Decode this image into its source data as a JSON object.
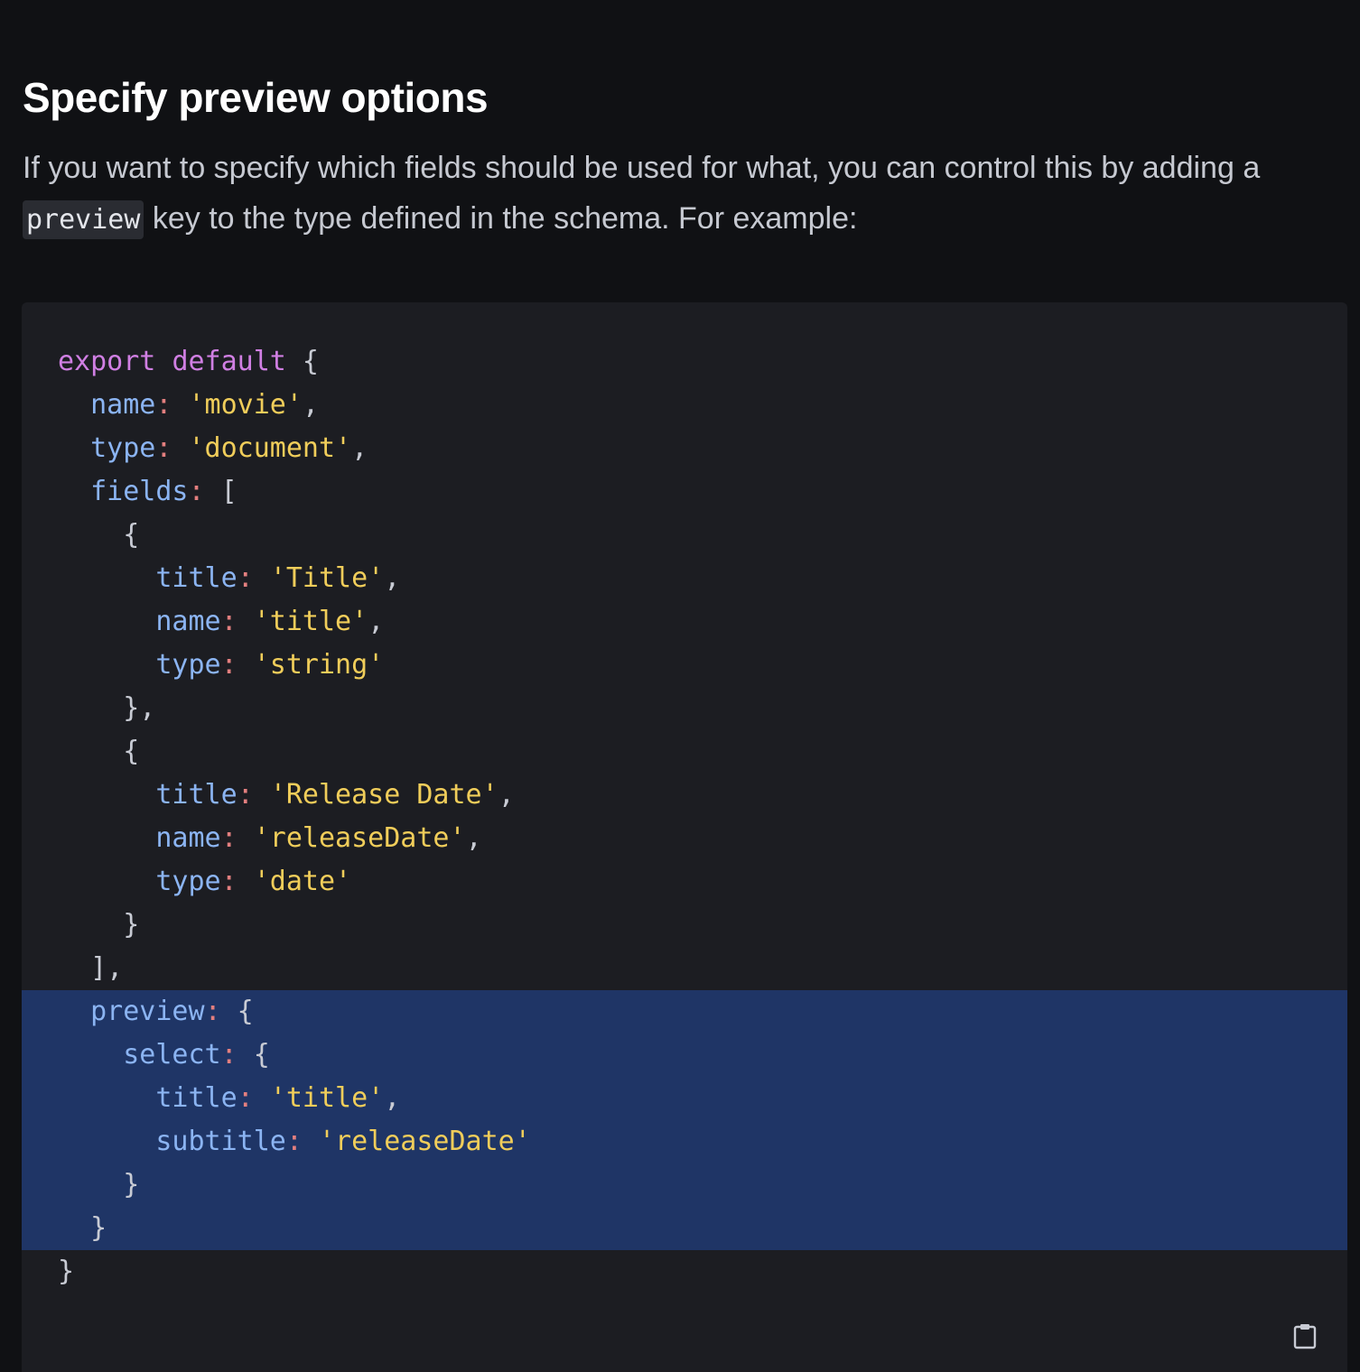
{
  "heading": "Specify preview options",
  "intro": {
    "before_code": "If you want to specify which fields should be used for what, you can control this by adding a ",
    "inline_code": "preview",
    "after_code": " key to the type defined in the schema. For example:"
  },
  "code": {
    "lines": [
      {
        "highlight": false,
        "tokens": [
          {
            "t": "kw",
            "v": "export"
          },
          {
            "t": "brace",
            "v": " "
          },
          {
            "t": "kw",
            "v": "default"
          },
          {
            "t": "brace",
            "v": " {"
          }
        ]
      },
      {
        "highlight": false,
        "tokens": [
          {
            "t": "brace",
            "v": "  "
          },
          {
            "t": "prop",
            "v": "name"
          },
          {
            "t": "punc",
            "v": ":"
          },
          {
            "t": "brace",
            "v": " "
          },
          {
            "t": "str",
            "v": "'movie'"
          },
          {
            "t": "brace",
            "v": ","
          }
        ]
      },
      {
        "highlight": false,
        "tokens": [
          {
            "t": "brace",
            "v": "  "
          },
          {
            "t": "prop",
            "v": "type"
          },
          {
            "t": "punc",
            "v": ":"
          },
          {
            "t": "brace",
            "v": " "
          },
          {
            "t": "str",
            "v": "'document'"
          },
          {
            "t": "brace",
            "v": ","
          }
        ]
      },
      {
        "highlight": false,
        "tokens": [
          {
            "t": "brace",
            "v": "  "
          },
          {
            "t": "prop",
            "v": "fields"
          },
          {
            "t": "punc",
            "v": ":"
          },
          {
            "t": "brace",
            "v": " ["
          }
        ]
      },
      {
        "highlight": false,
        "tokens": [
          {
            "t": "brace",
            "v": "    {"
          }
        ]
      },
      {
        "highlight": false,
        "tokens": [
          {
            "t": "brace",
            "v": "      "
          },
          {
            "t": "prop",
            "v": "title"
          },
          {
            "t": "punc",
            "v": ":"
          },
          {
            "t": "brace",
            "v": " "
          },
          {
            "t": "str",
            "v": "'Title'"
          },
          {
            "t": "brace",
            "v": ","
          }
        ]
      },
      {
        "highlight": false,
        "tokens": [
          {
            "t": "brace",
            "v": "      "
          },
          {
            "t": "prop",
            "v": "name"
          },
          {
            "t": "punc",
            "v": ":"
          },
          {
            "t": "brace",
            "v": " "
          },
          {
            "t": "str",
            "v": "'title'"
          },
          {
            "t": "brace",
            "v": ","
          }
        ]
      },
      {
        "highlight": false,
        "tokens": [
          {
            "t": "brace",
            "v": "      "
          },
          {
            "t": "prop",
            "v": "type"
          },
          {
            "t": "punc",
            "v": ":"
          },
          {
            "t": "brace",
            "v": " "
          },
          {
            "t": "str",
            "v": "'string'"
          }
        ]
      },
      {
        "highlight": false,
        "tokens": [
          {
            "t": "brace",
            "v": "    },"
          }
        ]
      },
      {
        "highlight": false,
        "tokens": [
          {
            "t": "brace",
            "v": "    {"
          }
        ]
      },
      {
        "highlight": false,
        "tokens": [
          {
            "t": "brace",
            "v": "      "
          },
          {
            "t": "prop",
            "v": "title"
          },
          {
            "t": "punc",
            "v": ":"
          },
          {
            "t": "brace",
            "v": " "
          },
          {
            "t": "str",
            "v": "'Release Date'"
          },
          {
            "t": "brace",
            "v": ","
          }
        ]
      },
      {
        "highlight": false,
        "tokens": [
          {
            "t": "brace",
            "v": "      "
          },
          {
            "t": "prop",
            "v": "name"
          },
          {
            "t": "punc",
            "v": ":"
          },
          {
            "t": "brace",
            "v": " "
          },
          {
            "t": "str",
            "v": "'releaseDate'"
          },
          {
            "t": "brace",
            "v": ","
          }
        ]
      },
      {
        "highlight": false,
        "tokens": [
          {
            "t": "brace",
            "v": "      "
          },
          {
            "t": "prop",
            "v": "type"
          },
          {
            "t": "punc",
            "v": ":"
          },
          {
            "t": "brace",
            "v": " "
          },
          {
            "t": "str",
            "v": "'date'"
          }
        ]
      },
      {
        "highlight": false,
        "tokens": [
          {
            "t": "brace",
            "v": "    }"
          }
        ]
      },
      {
        "highlight": false,
        "tokens": [
          {
            "t": "brace",
            "v": "  ],"
          }
        ]
      },
      {
        "highlight": true,
        "tokens": [
          {
            "t": "brace",
            "v": "  "
          },
          {
            "t": "prop",
            "v": "preview"
          },
          {
            "t": "punc",
            "v": ":"
          },
          {
            "t": "brace",
            "v": " {"
          }
        ]
      },
      {
        "highlight": true,
        "tokens": [
          {
            "t": "brace",
            "v": "    "
          },
          {
            "t": "prop",
            "v": "select"
          },
          {
            "t": "punc",
            "v": ":"
          },
          {
            "t": "brace",
            "v": " {"
          }
        ]
      },
      {
        "highlight": true,
        "tokens": [
          {
            "t": "brace",
            "v": "      "
          },
          {
            "t": "prop",
            "v": "title"
          },
          {
            "t": "punc",
            "v": ":"
          },
          {
            "t": "brace",
            "v": " "
          },
          {
            "t": "str",
            "v": "'title'"
          },
          {
            "t": "brace",
            "v": ","
          }
        ]
      },
      {
        "highlight": true,
        "tokens": [
          {
            "t": "brace",
            "v": "      "
          },
          {
            "t": "prop",
            "v": "subtitle"
          },
          {
            "t": "punc",
            "v": ":"
          },
          {
            "t": "brace",
            "v": " "
          },
          {
            "t": "str",
            "v": "'releaseDate'"
          }
        ]
      },
      {
        "highlight": true,
        "tokens": [
          {
            "t": "brace",
            "v": "    }"
          }
        ]
      },
      {
        "highlight": true,
        "tokens": [
          {
            "t": "brace",
            "v": "  }"
          }
        ]
      },
      {
        "highlight": false,
        "tokens": [
          {
            "t": "brace",
            "v": "}"
          }
        ]
      }
    ]
  },
  "copy_icon": "clipboard-icon",
  "colors": {
    "background": "#101114",
    "code_background": "#1c1d22",
    "highlight": "#1f3566",
    "keyword": "#d07fe3",
    "property": "#8bb4f2",
    "punctuation": "#e37f7f",
    "string": "#f0cd5a"
  }
}
